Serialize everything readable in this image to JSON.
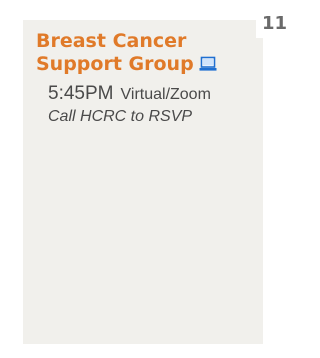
{
  "day": {
    "number": "11"
  },
  "event": {
    "title_line1": "Breast Cancer",
    "title_line2": "Support Group",
    "icon": "laptop-icon",
    "time": "5:45PM",
    "location": "Virtual/Zoom",
    "note": "Call HCRC to RSVP"
  },
  "colors": {
    "accent": "#e07a29",
    "icon_blue": "#1f6fd1",
    "cell_background": "#f1f0ec",
    "text": "#4a4a4a",
    "day_number": "#6a6a6a"
  }
}
